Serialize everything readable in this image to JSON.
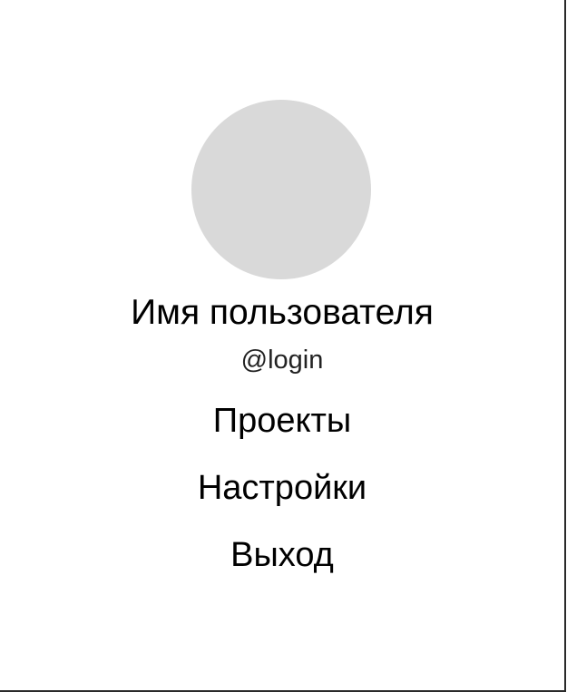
{
  "profile": {
    "avatar_color": "#d9d9d9",
    "name": "Имя пользователя",
    "login": "@login"
  },
  "menu": {
    "items": [
      {
        "label": "Проекты"
      },
      {
        "label": "Настройки"
      },
      {
        "label": "Выход"
      }
    ]
  }
}
